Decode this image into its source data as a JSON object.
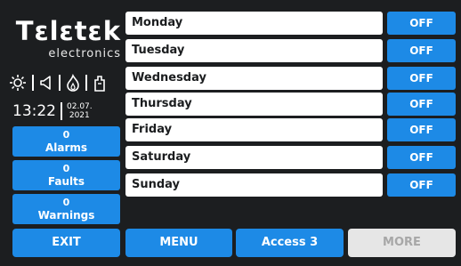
{
  "logo": {
    "brand": "Tεlεtεk",
    "sub": "electronics"
  },
  "status_icons": [
    "sun-icon",
    "speaker-icon",
    "flame-icon",
    "hand-icon"
  ],
  "clock": {
    "time": "13:22",
    "date_line1": "02.07.",
    "date_line2": "2021"
  },
  "counters": [
    {
      "count": "0",
      "label": "Alarms"
    },
    {
      "count": "0",
      "label": "Faults"
    },
    {
      "count": "0",
      "label": "Warnings"
    }
  ],
  "days": [
    {
      "name": "Monday",
      "state": "OFF"
    },
    {
      "name": "Tuesday",
      "state": "OFF"
    },
    {
      "name": "Wednesday",
      "state": "OFF"
    },
    {
      "name": "Thursday",
      "state": "OFF"
    },
    {
      "name": "Friday",
      "state": "OFF"
    },
    {
      "name": "Saturday",
      "state": "OFF"
    },
    {
      "name": "Sunday",
      "state": "OFF"
    }
  ],
  "bottom": {
    "exit": "EXIT",
    "menu": "MENU",
    "access": "Access 3",
    "more": "MORE"
  },
  "colors": {
    "accent": "#1d8ae6",
    "background": "#1c1e20",
    "disabled": "#e6e6e6"
  }
}
